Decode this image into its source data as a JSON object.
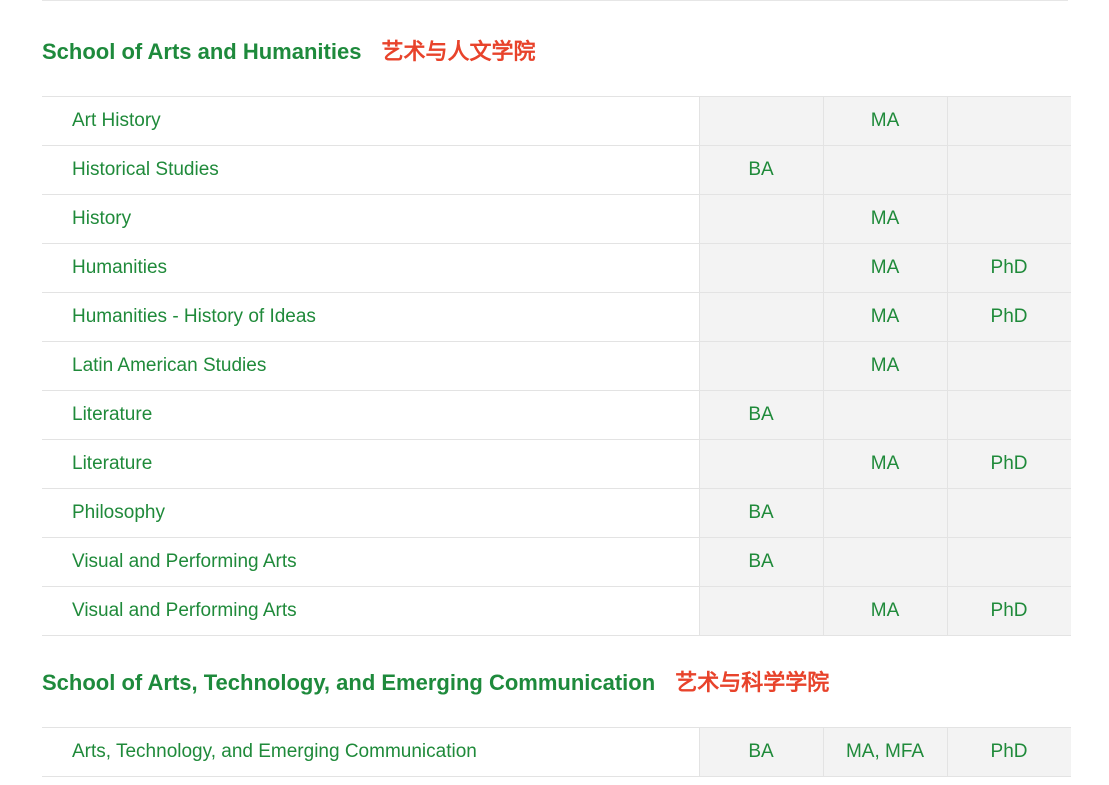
{
  "sections": [
    {
      "title_en": "School of Arts and Humanities",
      "title_zh": "艺术与人文学院",
      "rows": [
        {
          "program": "Art History",
          "ba": "",
          "ma": "MA",
          "phd": ""
        },
        {
          "program": "Historical Studies",
          "ba": "BA",
          "ma": "",
          "phd": ""
        },
        {
          "program": "History",
          "ba": "",
          "ma": "MA",
          "phd": ""
        },
        {
          "program": "Humanities",
          "ba": "",
          "ma": "MA",
          "phd": "PhD"
        },
        {
          "program": "Humanities - History of Ideas",
          "ba": "",
          "ma": "MA",
          "phd": "PhD"
        },
        {
          "program": "Latin American Studies",
          "ba": "",
          "ma": "MA",
          "phd": ""
        },
        {
          "program": "Literature",
          "ba": "BA",
          "ma": "",
          "phd": ""
        },
        {
          "program": "Literature",
          "ba": "",
          "ma": "MA",
          "phd": "PhD"
        },
        {
          "program": "Philosophy",
          "ba": "BA",
          "ma": "",
          "phd": ""
        },
        {
          "program": "Visual and Performing Arts",
          "ba": "BA",
          "ma": "",
          "phd": ""
        },
        {
          "program": "Visual and Performing Arts",
          "ba": "",
          "ma": "MA",
          "phd": "PhD"
        }
      ]
    },
    {
      "title_en": "School of Arts, Technology, and Emerging Communication",
      "title_zh": "艺术与科学学院",
      "rows": [
        {
          "program": "Arts, Technology, and Emerging Communication",
          "ba": "BA",
          "ma": "MA, MFA",
          "phd": "PhD"
        }
      ]
    }
  ],
  "colors": {
    "green": "#1f8a3a",
    "red": "#e8432b",
    "cell_bg": "#f3f3f3",
    "border": "#e3e3e3"
  }
}
